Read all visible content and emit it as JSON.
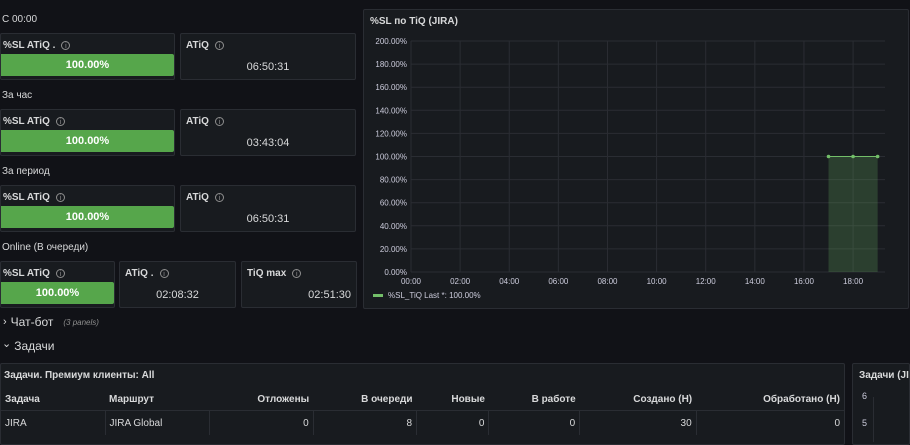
{
  "sections": {
    "since_midnight": "С 00:00",
    "last_hour": "За час",
    "period": "За период",
    "online": "Online (В очереди)"
  },
  "panels": {
    "s1_sl": {
      "title": "%SL ATiQ .",
      "value": "100.00%",
      "fill": 1.0
    },
    "s1_atiq": {
      "title": "ATiQ",
      "value": "06:50:31"
    },
    "s2_sl": {
      "title": "%SL ATiQ",
      "value": "100.00%",
      "fill": 1.0
    },
    "s2_atiq": {
      "title": "ATiQ",
      "value": "03:43:04"
    },
    "s3_sl": {
      "title": "%SL ATiQ",
      "value": "100.00%",
      "fill": 1.0
    },
    "s3_atiq": {
      "title": "ATiQ",
      "value": "06:50:31"
    },
    "s4_sl": {
      "title": "%SL ATiQ",
      "value": "100.00%",
      "fill": 1.0
    },
    "s4_atiq": {
      "title": "ATiQ .",
      "value": "02:08:32"
    },
    "s4_tiqmax": {
      "title": "TiQ max",
      "value": "02:51:30"
    }
  },
  "info_glyph": "i",
  "chart_panel_title": "%SL по TiQ (JIRA)",
  "chart_data": {
    "type": "area",
    "yticks": [
      "0.00%",
      "20.00%",
      "40.00%",
      "60.00%",
      "80.00%",
      "100.00%",
      "120.00%",
      "140.00%",
      "160.00%",
      "180.00%",
      "200.00%"
    ],
    "ylim": [
      0,
      200
    ],
    "xticks": [
      "00:00",
      "02:00",
      "04:00",
      "06:00",
      "08:00",
      "10:00",
      "12:00",
      "14:00",
      "16:00",
      "18:00"
    ],
    "xlim_hours": [
      0,
      19.3
    ],
    "series": [
      {
        "name": "%SL_TiQ",
        "x_hours": [
          17,
          18,
          19
        ],
        "values": [
          100,
          100,
          100
        ],
        "color": "#73bf69"
      }
    ],
    "legend_text": "%SL_TiQ  Last *: 100.00%",
    "grid": true
  },
  "rows": {
    "chatbot": {
      "label": "Чат-бот",
      "count": "(3 panels)",
      "chevron": "›"
    },
    "tasks": {
      "label": "Задачи",
      "chevron": "⌄"
    }
  },
  "tasks_table": {
    "title": "Задачи. Премиум клиенты: All",
    "columns": [
      "Задача",
      "Маршрут",
      "Отложены",
      "В очереди",
      "Новые",
      "В работе",
      "Создано (Н)",
      "Обработано (Н)"
    ],
    "rows": [
      [
        "JIRA",
        "JIRA Global",
        "0",
        "8",
        "0",
        "0",
        "30",
        "0"
      ]
    ]
  },
  "right_panel": {
    "title": "Задачи (JIR",
    "y1": "6",
    "y2": "5"
  }
}
